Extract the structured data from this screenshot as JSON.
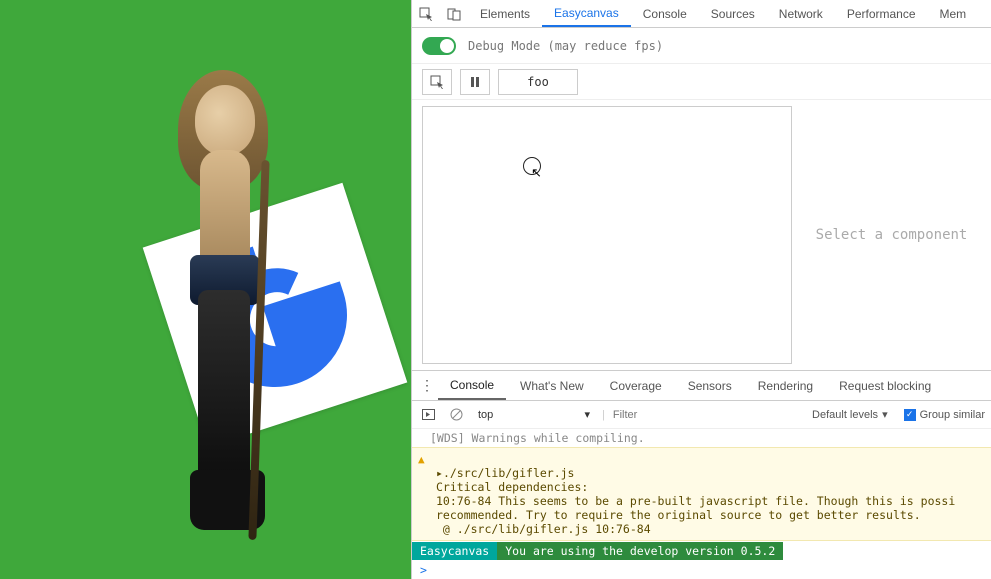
{
  "devtools_tabs": [
    "Elements",
    "Easycanvas",
    "Console",
    "Sources",
    "Network",
    "Performance",
    "Mem"
  ],
  "devtools_active_tab": "Easycanvas",
  "debug_mode_label": "Debug Mode (may reduce fps)",
  "debug_mode_enabled": true,
  "tool_buttons": {
    "foo_label": "foo"
  },
  "detail_placeholder": "Select a component",
  "drawer_tabs": [
    "Console",
    "What's New",
    "Coverage",
    "Sensors",
    "Rendering",
    "Request blocking"
  ],
  "drawer_active_tab": "Console",
  "console_toolbar": {
    "context": "top",
    "filter_placeholder": "Filter",
    "level_label": "Default levels",
    "group_similar_label": "Group similar",
    "group_similar_checked": true
  },
  "console_messages": {
    "dim_prev": "[WDS] Warnings while compiling.",
    "warning": {
      "file": "./src/lib/gifler.js",
      "l1": "Critical dependencies:",
      "l2": "10:76-84 This seems to be a pre-built javascript file. Though this is possi",
      "l3": "recommended. Try to require the original source to get better results.",
      "l4": " @ ./src/lib/gifler.js 10:76-84"
    },
    "badge": {
      "name": "Easycanvas",
      "msg": "You are using the develop version 0.5.2"
    },
    "prompt": ">"
  },
  "canvas": {
    "logo_letter": "G",
    "accent": "#3fa83b",
    "g_color": "#2a6ff0"
  }
}
